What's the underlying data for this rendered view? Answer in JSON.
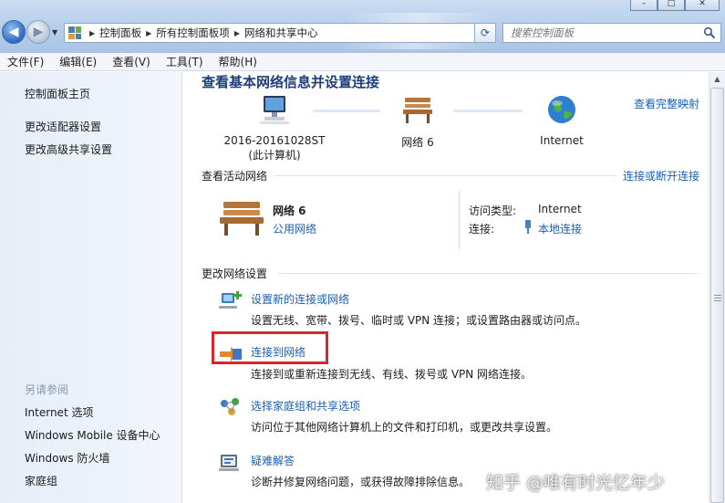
{
  "window": {
    "buttons": [
      "–",
      "□",
      "✕"
    ]
  },
  "address_bar": {
    "crumbs": [
      "控制面板",
      "所有控制面板项",
      "网络和共享中心"
    ],
    "search_placeholder": "搜索控制面板"
  },
  "menu": [
    "文件(F)",
    "编辑(E)",
    "查看(V)",
    "工具(T)",
    "帮助(H)"
  ],
  "sidebar": {
    "links": [
      "控制面板主页",
      "更改适配器设置",
      "更改高级共享设置"
    ],
    "see_also_heading": "另请参阅",
    "see_also": [
      "Internet 选项",
      "Windows Mobile 设备中心",
      "Windows 防火墙",
      "家庭组"
    ]
  },
  "main": {
    "title": "查看基本网络信息并设置连接",
    "full_map_link": "查看完整映射",
    "map": {
      "computer_name": "2016-20161028ST",
      "computer_note": "(此计算机)",
      "network": "网络  6",
      "internet": "Internet"
    },
    "active_heading": "查看活动网络",
    "connect_link": "连接或断开连接",
    "active_network": {
      "name": "网络  6",
      "type": "公用网络",
      "access_label": "访问类型:",
      "access_value": "Internet",
      "connection_label": "连接:",
      "connection_value": "本地连接"
    },
    "change_heading": "更改网络设置",
    "tasks": [
      {
        "title": "设置新的连接或网络",
        "desc": "设置无线、宽带、拨号、临时或 VPN 连接；或设置路由器或访问点。",
        "icon": "new-connection-icon"
      },
      {
        "title": "连接到网络",
        "desc": "连接到或重新连接到无线、有线、拨号或 VPN 网络连接。",
        "icon": "connect-network-icon"
      },
      {
        "title": "选择家庭组和共享选项",
        "desc": "访问位于其他网络计算机上的文件和打印机，或更改共享设置。",
        "icon": "homegroup-icon"
      },
      {
        "title": "疑难解答",
        "desc": "诊断并修复网络问题，或获得故障排除信息。",
        "icon": "troubleshoot-icon"
      }
    ]
  },
  "watermark": "知乎 @唯有时光忆年少",
  "colors": {
    "link": "#1a5fb4",
    "title": "#1e3f7a",
    "highlight": "#d8262a"
  }
}
